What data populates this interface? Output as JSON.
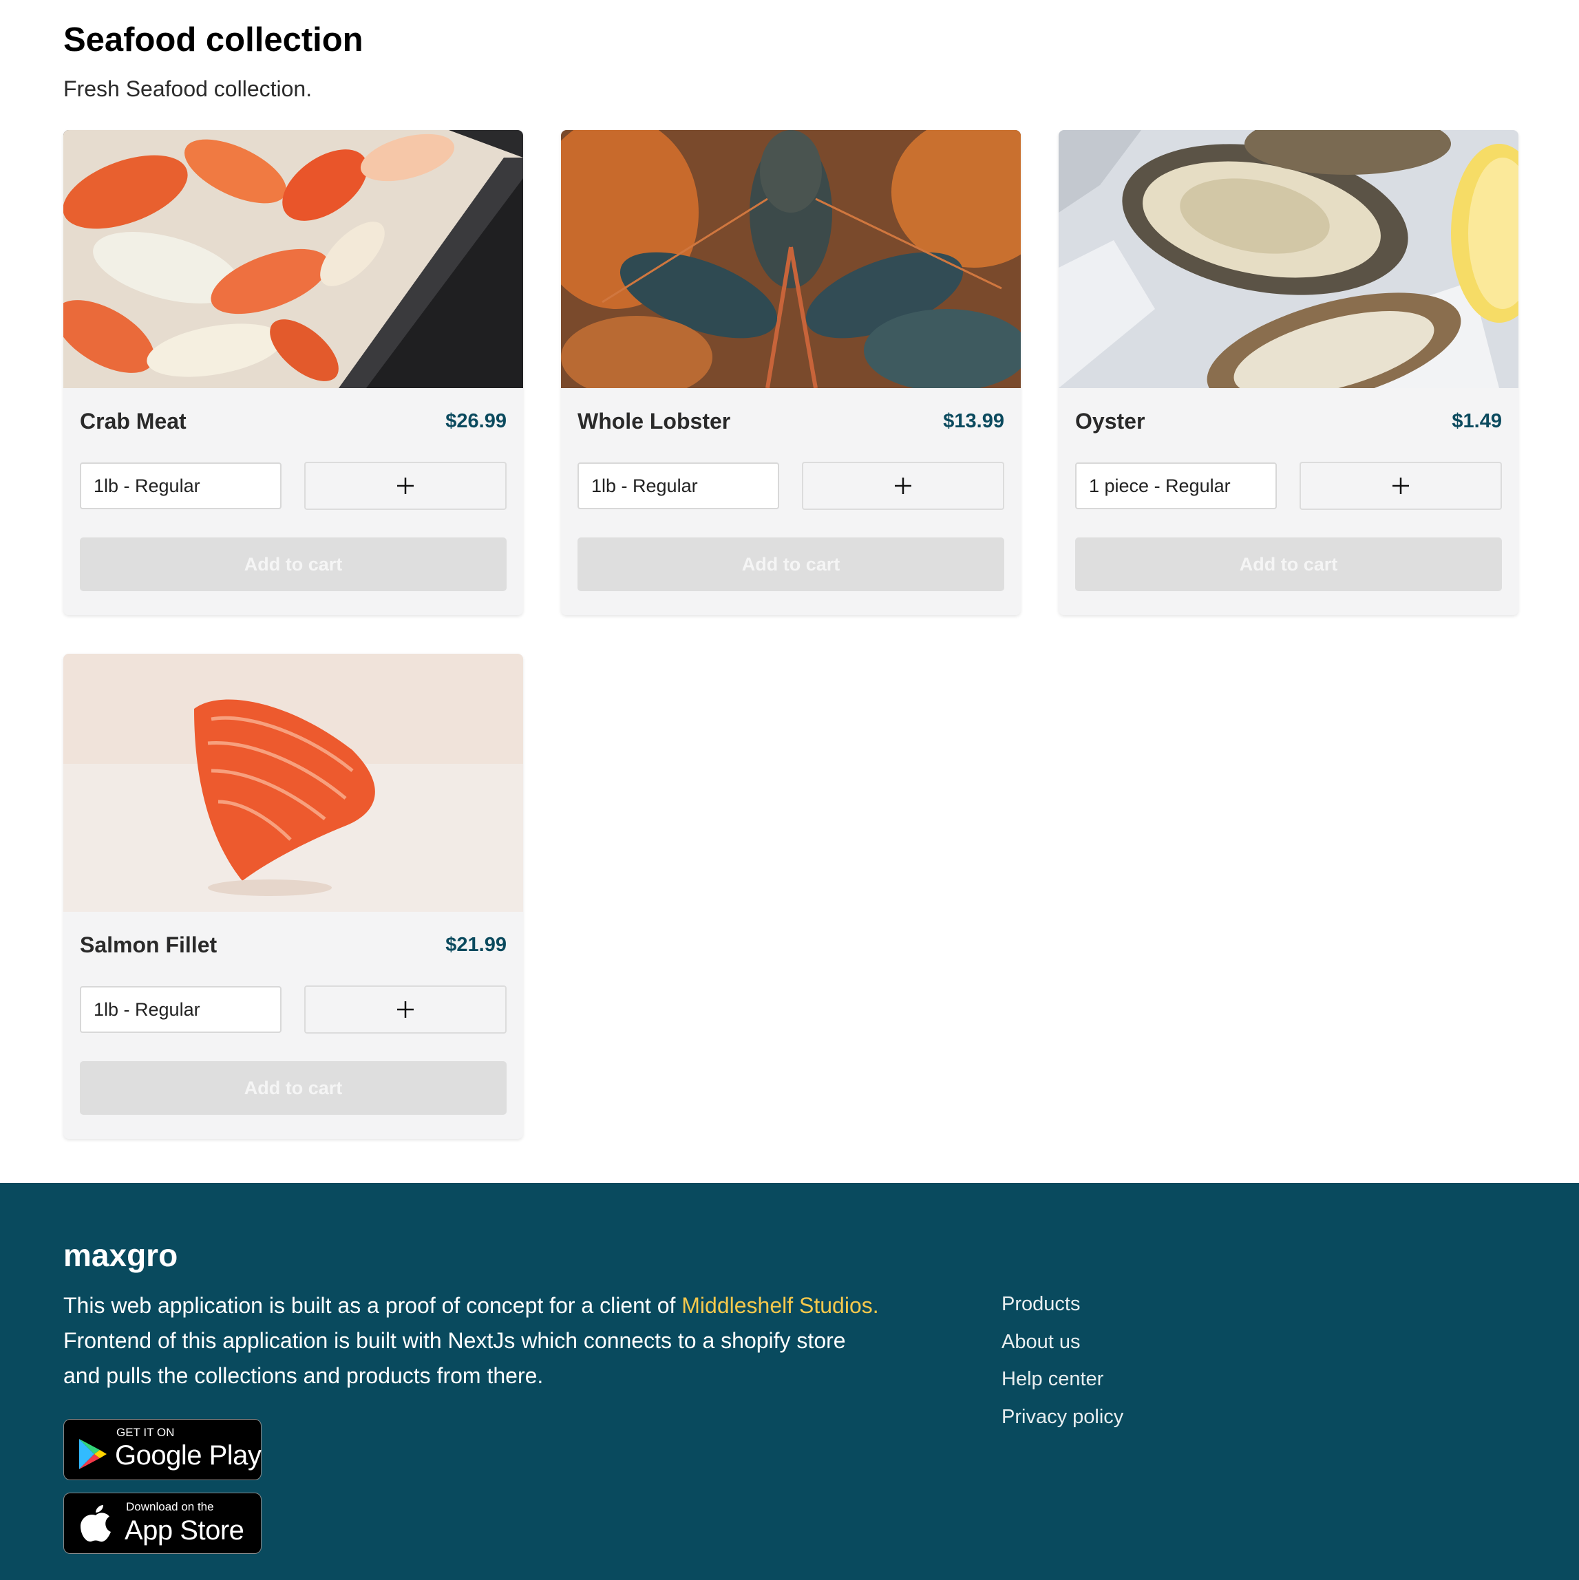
{
  "collection": {
    "title": "Seafood collection",
    "description": "Fresh Seafood collection."
  },
  "products": [
    {
      "name": "Crab Meat",
      "price": "$26.99",
      "variant": "1lb - Regular",
      "add_label": "Add to cart",
      "image_icon": "crab-meat-photo"
    },
    {
      "name": "Whole Lobster",
      "price": "$13.99",
      "variant": "1lb - Regular",
      "add_label": "Add to cart",
      "image_icon": "lobster-photo"
    },
    {
      "name": "Oyster",
      "price": "$1.49",
      "variant": "1 piece - Regular",
      "add_label": "Add to cart",
      "image_icon": "oyster-photo"
    },
    {
      "name": "Salmon Fillet",
      "price": "$21.99",
      "variant": "1lb - Regular",
      "add_label": "Add to cart",
      "image_icon": "salmon-photo"
    }
  ],
  "footer": {
    "brand": "maxgro",
    "about_before": "This web application is built as a proof of concept for a client of ",
    "about_link": "Middleshelf Studios.",
    "about_after": " Frontend of this application is built with NextJs which connects to a shopify store and pulls the collections and products from there.",
    "links": [
      "Products",
      "About us",
      "Help center",
      "Privacy policy"
    ],
    "google_play": {
      "small": "GET IT ON",
      "big": "Google Play"
    },
    "app_store": {
      "small": "Download on the",
      "big": "App Store"
    }
  },
  "colors": {
    "footer_bg": "#094a5e",
    "price": "#0b4a5e",
    "highlight": "#f5c84c",
    "card_bg": "#f4f4f5",
    "button_disabled": "#dedede"
  }
}
